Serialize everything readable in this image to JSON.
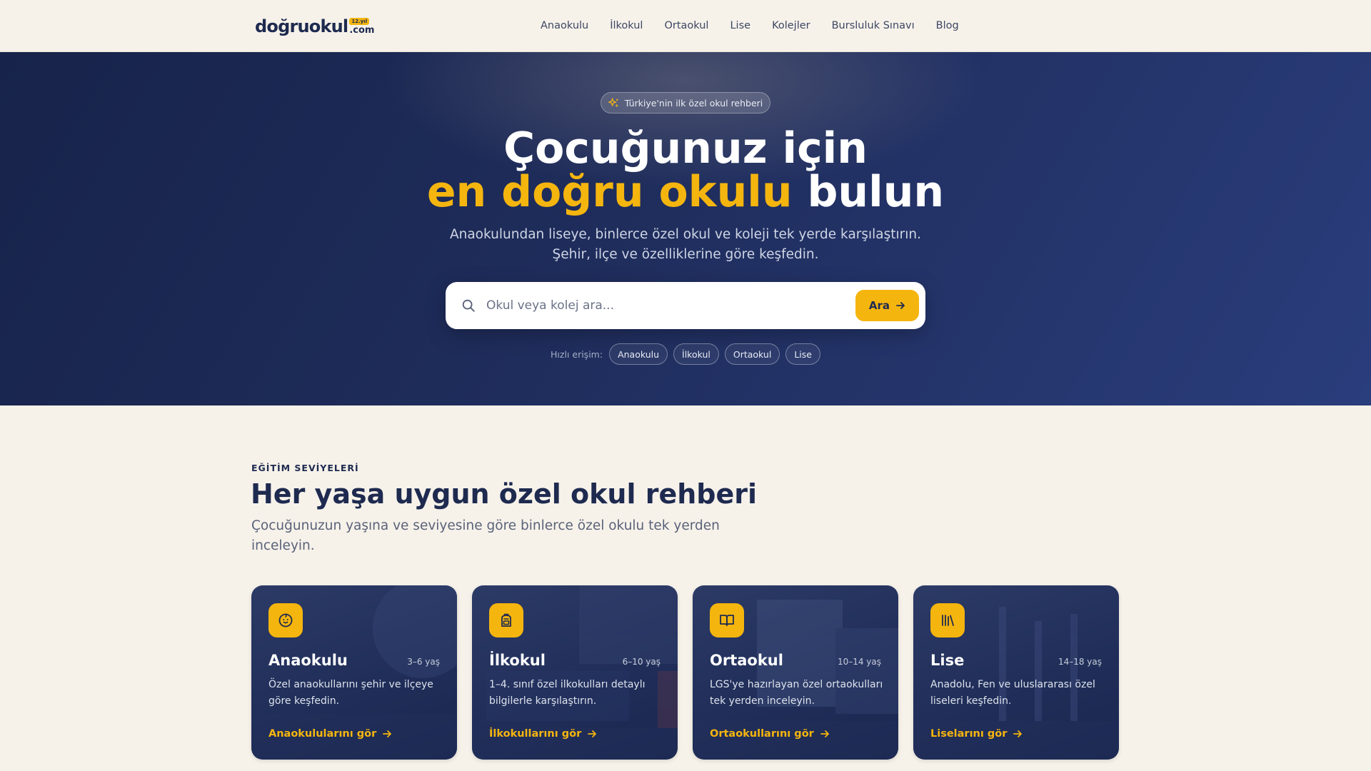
{
  "header": {
    "logo": {
      "word": "doğruokul",
      "badge": "12.yıl",
      "suffix": ".com"
    },
    "nav": [
      "Anaokulu",
      "İlkokul",
      "Ortaokul",
      "Lise",
      "Kolejler",
      "Bursluluk Sınavı",
      "Blog"
    ]
  },
  "hero": {
    "badge": "Türkiye'nin ilk özel okul rehberi",
    "title_line1": "Çocuğunuz için",
    "title_accent": "en doğru okulu",
    "title_rest": " bulun",
    "subtitle_line1": "Anaokulundan liseye, binlerce özel okul ve koleji tek yerde karşılaştırın.",
    "subtitle_line2": "Şehir, ilçe ve özelliklerine göre keşfedin.",
    "search": {
      "placeholder": "Okul veya kolej ara...",
      "button": "Ara"
    },
    "quick_label": "Hızlı erişim:",
    "quick_links": [
      "Anaokulu",
      "İlkokul",
      "Ortaokul",
      "Lise"
    ]
  },
  "levels": {
    "eyebrow": "EĞİTİM SEVİYELERİ",
    "title": "Her yaşa uygun özel okul rehberi",
    "description": "Çocuğunuzun yaşına ve seviyesine göre binlerce özel okulu tek yerden inceleyin.",
    "cards": [
      {
        "title": "Anaokulu",
        "age": "3–6 yaş",
        "desc": "Özel anaokullarını şehir ve ilçeye göre keşfedin.",
        "cta": "Anaokulularını gör",
        "icon": "baby-face-icon"
      },
      {
        "title": "İlkokul",
        "age": "6–10 yaş",
        "desc": "1–4. sınıf özel ilkokulları detaylı bilgilerle karşılaştırın.",
        "cta": "İlkokullarını gör",
        "icon": "backpack-icon"
      },
      {
        "title": "Ortaokul",
        "age": "10–14 yaş",
        "desc": "LGS'ye hazırlayan özel ortaokulları tek yerden inceleyin.",
        "cta": "Ortaokullarını gör",
        "icon": "open-book-icon"
      },
      {
        "title": "Lise",
        "age": "14–18 yaş",
        "desc": "Anadolu, Fen ve uluslararası özel liseleri keşfedin.",
        "cta": "Liselarını gör",
        "icon": "library-icon"
      }
    ]
  },
  "colors": {
    "navy": "#1e2a4f",
    "accent": "#f5b50f",
    "background": "#f6f2ea"
  }
}
